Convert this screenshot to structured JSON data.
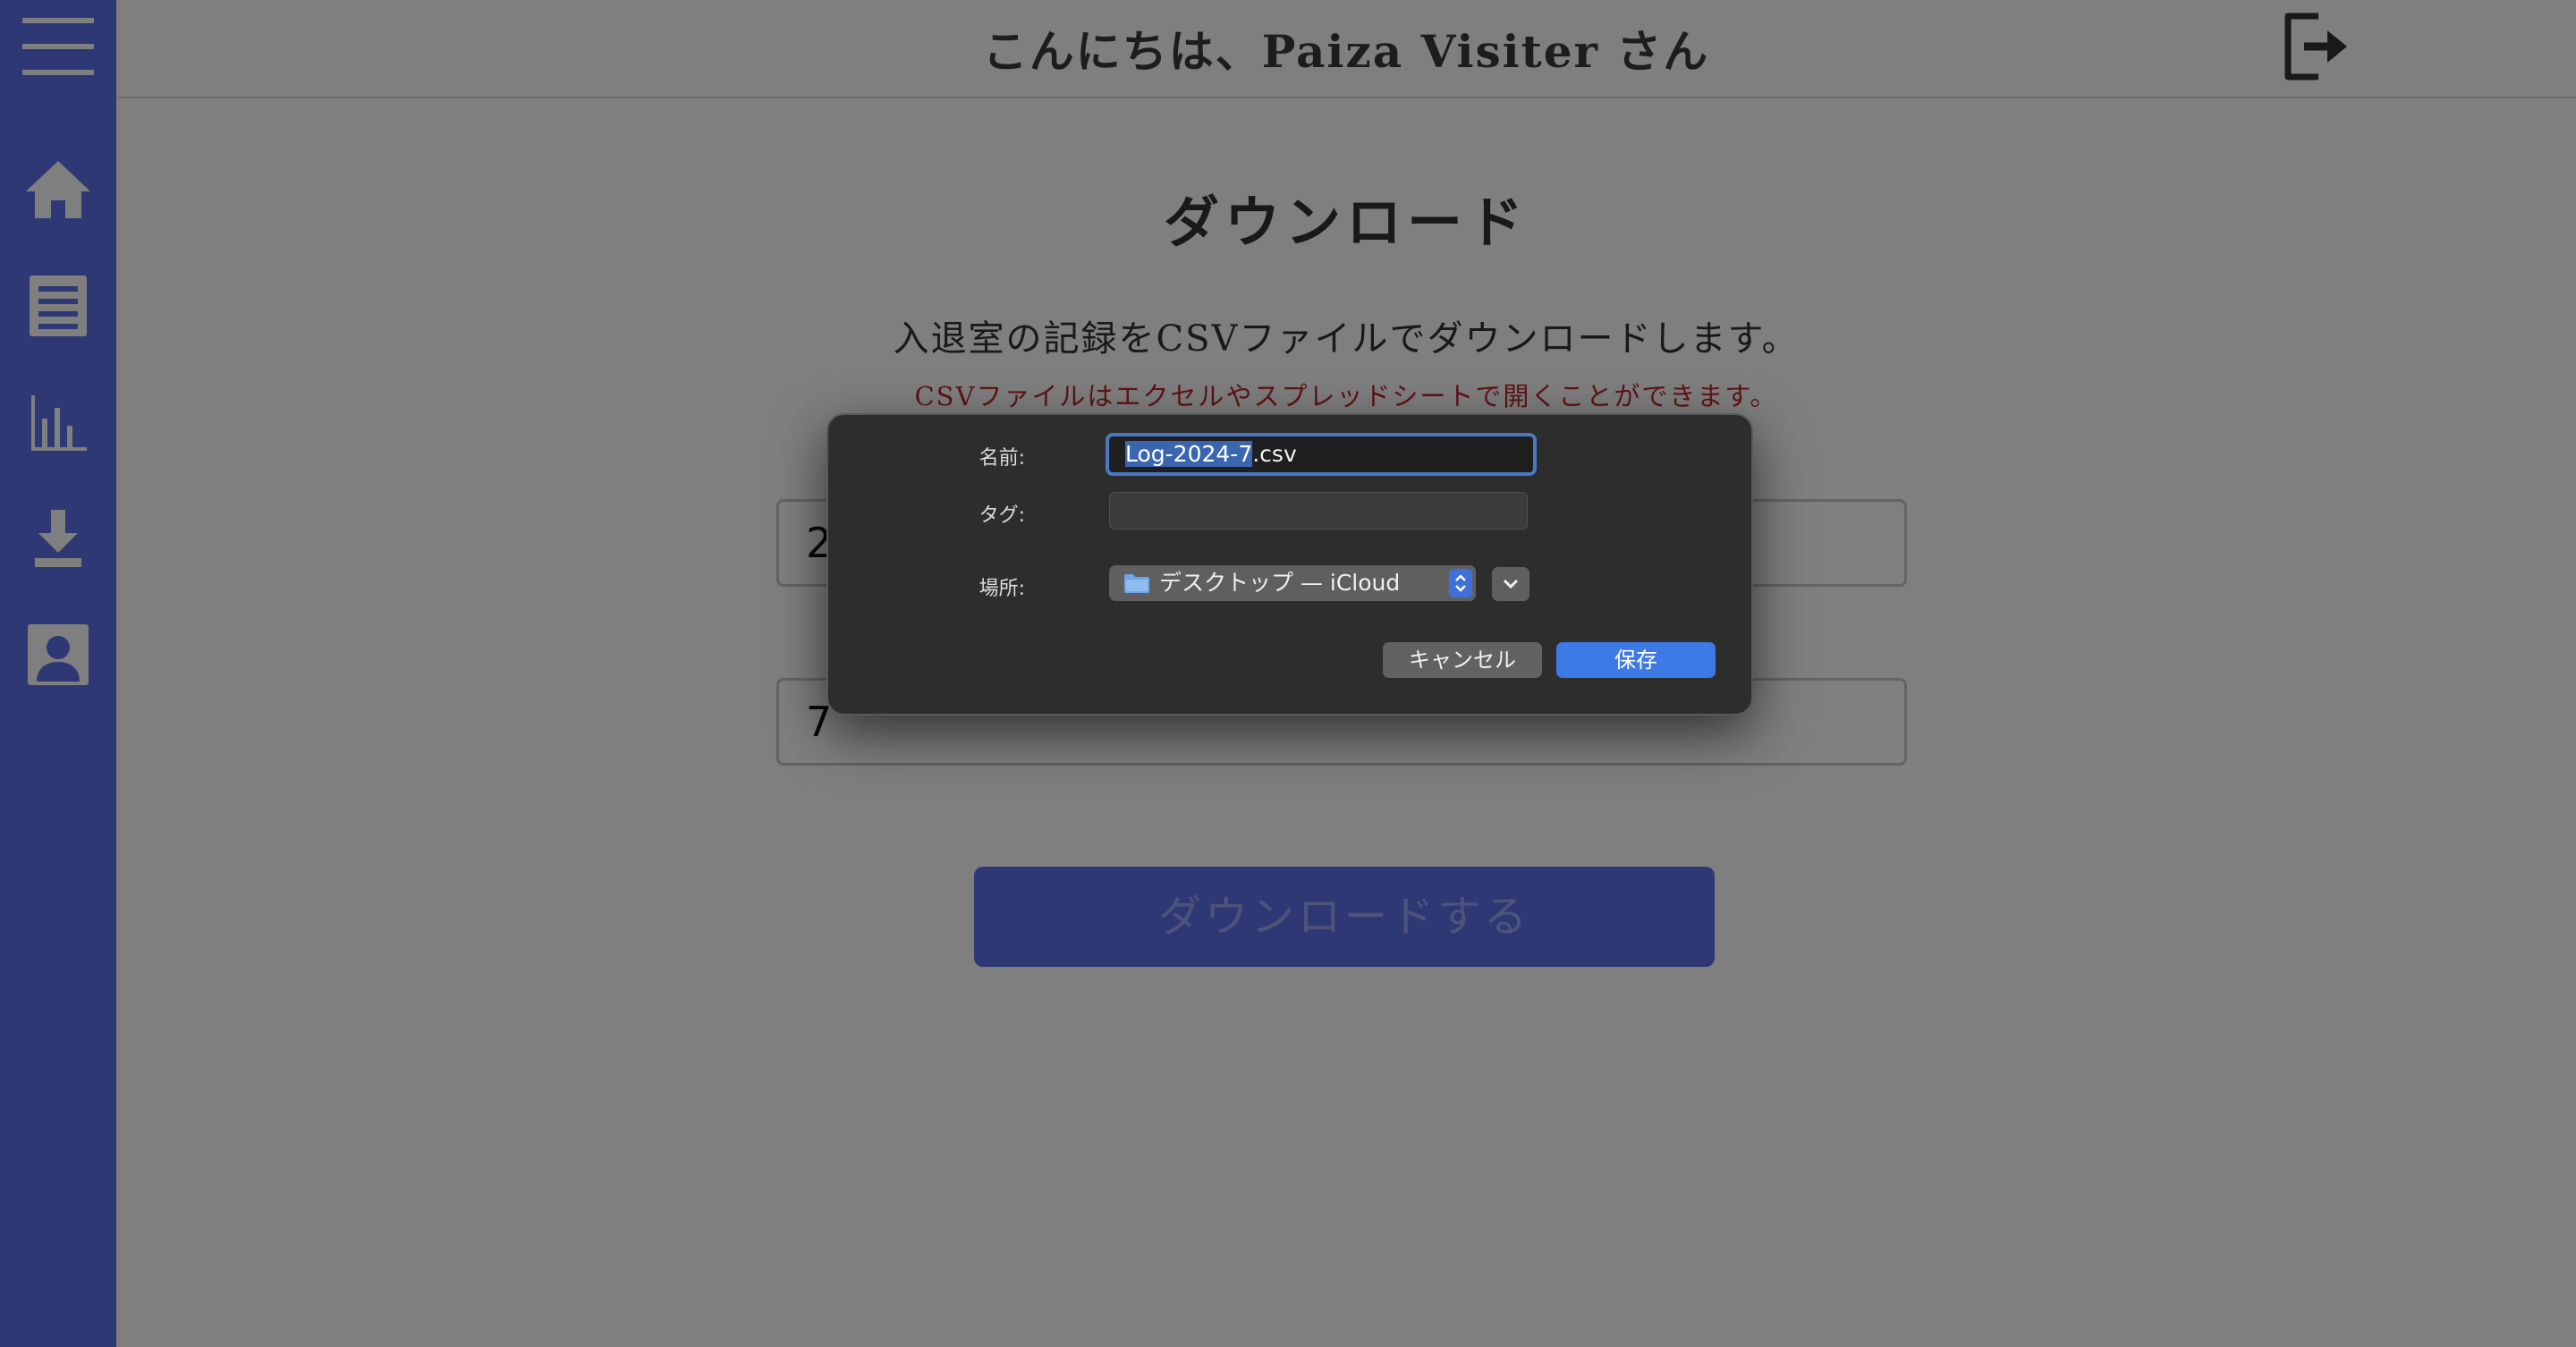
{
  "colors": {
    "sidebar": "#5d71ea",
    "accent_button": "#5d71ea",
    "note_text": "#c0262a",
    "dialog_bg": "#2d2d2d",
    "dialog_primary": "#3d7ae6"
  },
  "sidebar": {
    "items": [
      {
        "icon": "menu-icon"
      },
      {
        "icon": "home-icon"
      },
      {
        "icon": "list-icon"
      },
      {
        "icon": "chart-icon"
      },
      {
        "icon": "download-icon"
      },
      {
        "icon": "user-icon"
      }
    ]
  },
  "header": {
    "greeting": "こんにちは、Paiza Visiter さん",
    "logout_icon": "logout-icon"
  },
  "main": {
    "title": "ダウンロード",
    "description": "入退室の記録をCSVファイルでダウンロードします。",
    "note": "CSVファイルはエクセルやスプレッドシートで開くことができます。",
    "year_value": "2",
    "month_value": "7",
    "download_button": "ダウンロードする"
  },
  "save_dialog": {
    "name_label": "名前:",
    "file_name_selected": "Log-2024-7",
    "file_name_ext": ".csv",
    "tags_label": "タグ:",
    "tags_value": "",
    "location_label": "場所:",
    "location_value": "デスクトップ — iCloud",
    "cancel_label": "キャンセル",
    "save_label": "保存"
  }
}
